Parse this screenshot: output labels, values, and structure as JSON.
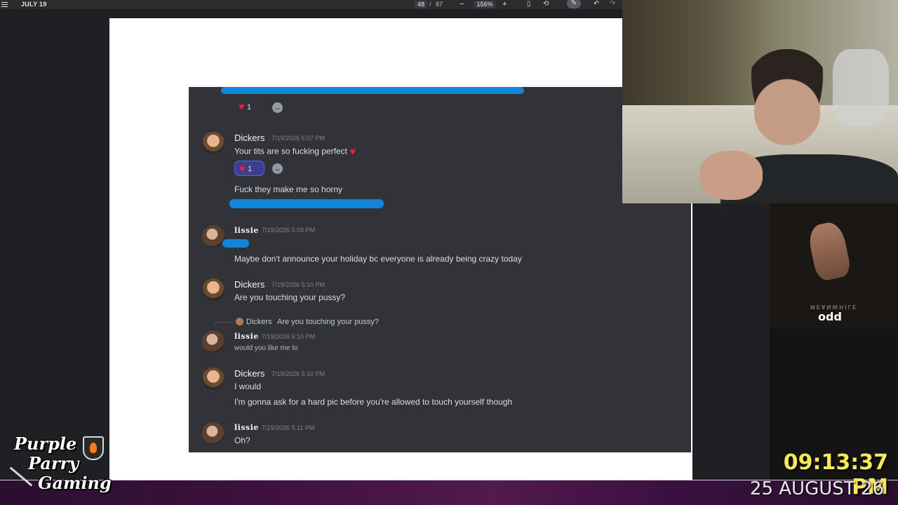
{
  "toolbar": {
    "doc_title": "JULY 19",
    "page_current": "48",
    "page_sep": "/",
    "page_total": "87",
    "zoom_minus": "−",
    "zoom": "156%",
    "zoom_plus": "+",
    "icons": [
      "menu-icon",
      "fit-page-icon",
      "rotate-icon",
      "draw-icon",
      "undo-icon",
      "redo-icon"
    ]
  },
  "discord": {
    "messages": [
      {
        "reaction_count": "1"
      },
      {
        "author": "Dickers",
        "timestamp": "7/19/2026 5:07 PM",
        "lines": [
          "Your tits are so fucking perfect"
        ],
        "reaction_count": "1",
        "followup": "Fuck they make me so horny"
      },
      {
        "author": "lissie",
        "timestamp": "7/19/2026 5:09 PM",
        "lines": [
          "Maybe don't announce your holiday bc everyone is already being crazy today"
        ]
      },
      {
        "author": "Dickers",
        "timestamp": "7/19/2026 5:10 PM",
        "lines": [
          "Are you touching your pussy?"
        ]
      },
      {
        "reply_to_author": "Dickers",
        "reply_to_text": "Are you touching your pussy?",
        "author": "lissie",
        "timestamp": "7/19/2026 5:10 PM",
        "lines": [
          "would you like me to"
        ]
      },
      {
        "author": "Dickers",
        "timestamp": "7/19/2026 5:10 PM",
        "lines": [
          "I would",
          "I'm gonna ask for a hard pic before you're allowed to touch yourself though"
        ]
      },
      {
        "author": "lissie",
        "timestamp": "7/19/2026 5:11 PM",
        "lines": [
          "Oh?"
        ]
      }
    ],
    "heart_glyph": "♥"
  },
  "overlay": {
    "album_subtitle": "MEANWHILE",
    "album_title": "odd",
    "logo_lines": [
      "Purple",
      "Parry",
      "Gaming"
    ],
    "clock_time": "09:13:37 PM",
    "clock_date": "25 AUGUST 26",
    "clock_color": "#f7e85a",
    "scribble_color": "#1185d9"
  }
}
